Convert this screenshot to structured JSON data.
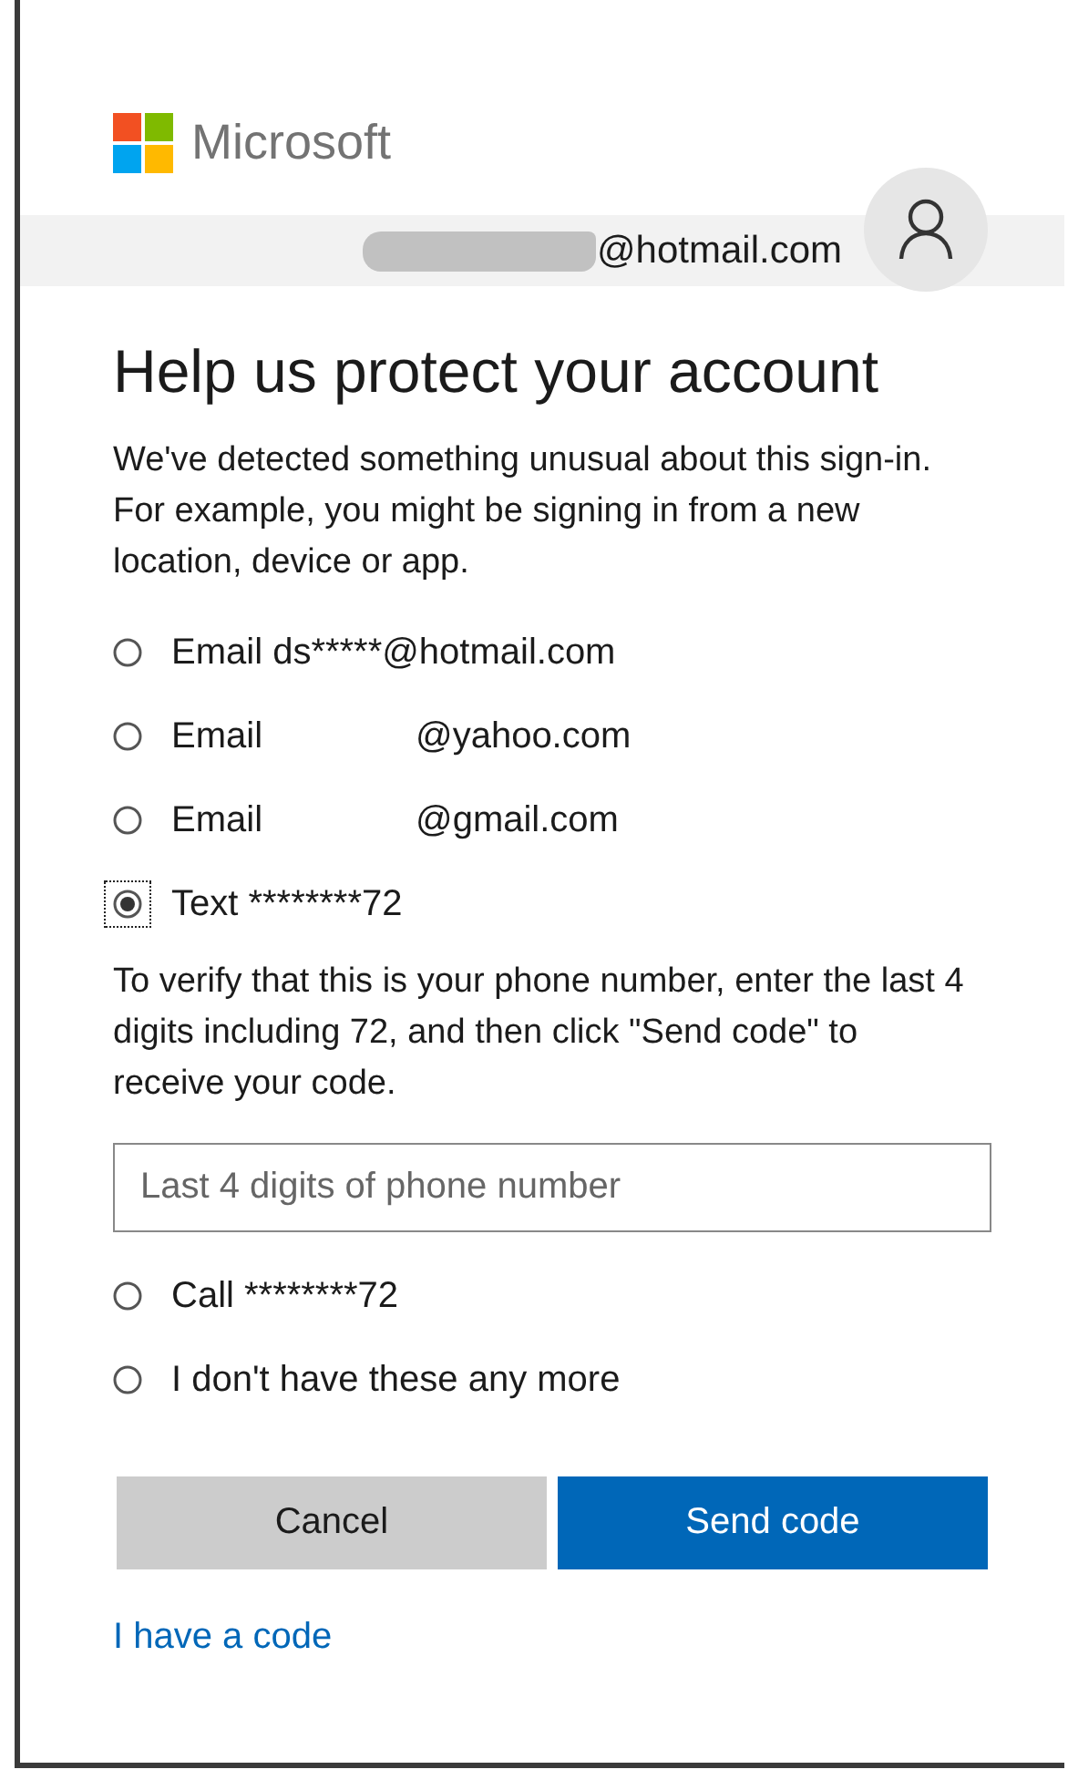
{
  "brand": {
    "name": "Microsoft"
  },
  "account": {
    "address": "@hotmail.com",
    "redacted": true
  },
  "title": "Help us protect your account",
  "intro": "We've detected something unusual about this sign-in. For example, you might be signing in from a new location, device or app.",
  "options": [
    {
      "label": "Email ds*****@hotmail.com",
      "selected": false
    },
    {
      "label": "Email",
      "address": "@yahoo.com",
      "selected": false
    },
    {
      "label": "Email",
      "address": "@gmail.com",
      "selected": false
    },
    {
      "label": "Text ********72",
      "selected": true,
      "instructions": "To verify that this is your phone number, enter the last 4 digits including 72, and then click \"Send code\" to receive your code.",
      "field": {
        "placeholder": "Last 4 digits of phone number"
      }
    },
    {
      "label": "Call ********72",
      "selected": false
    },
    {
      "label": "I don't have these any more",
      "selected": false
    }
  ],
  "buttons": [
    {
      "label": "Cancel",
      "kind": "secondary"
    },
    {
      "label": "Send code",
      "kind": "primary"
    }
  ],
  "link": "I have a code"
}
